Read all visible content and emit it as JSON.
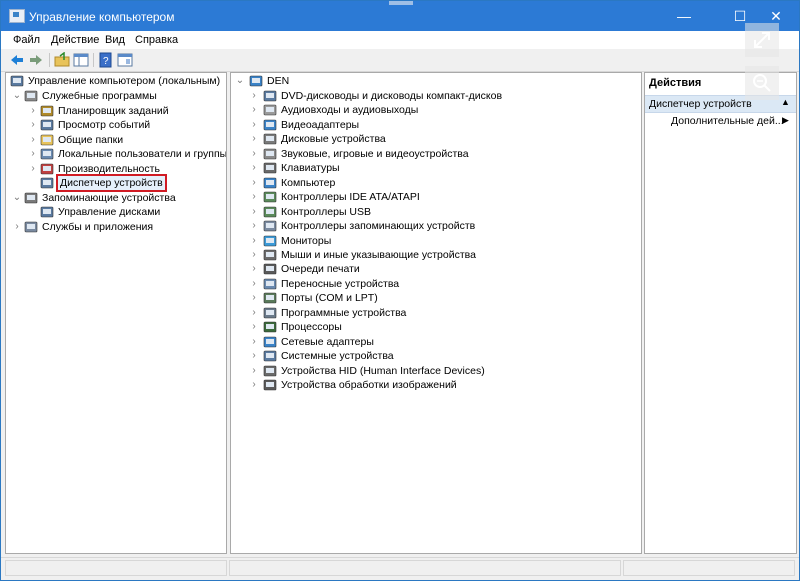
{
  "window": {
    "title": "Управление компьютером",
    "controls": [
      "—",
      "☐",
      "✕"
    ]
  },
  "menu": [
    "Файл",
    "Действие",
    "Вид",
    "Справка"
  ],
  "toolbar": {
    "icons": [
      "back-arrow-icon",
      "forward-arrow-icon",
      "up-folder-icon",
      "show-hide-tree-icon",
      "help-icon",
      "properties-icon"
    ]
  },
  "tree": {
    "root": "Управление компьютером (локальным)",
    "items": [
      {
        "label": "Служебные программы",
        "level": 1,
        "expand": "open"
      },
      {
        "label": "Планировщик заданий",
        "level": 2,
        "expand": "closed"
      },
      {
        "label": "Просмотр событий",
        "level": 2,
        "expand": "closed"
      },
      {
        "label": "Общие папки",
        "level": 2,
        "expand": "closed"
      },
      {
        "label": "Локальные пользователи и группы",
        "level": 2,
        "expand": "closed"
      },
      {
        "label": "Производительность",
        "level": 2,
        "expand": "closed"
      },
      {
        "label": "Диспетчер устройств",
        "level": 2,
        "expand": "none",
        "selected": true
      },
      {
        "label": "Запоминающие устройства",
        "level": 1,
        "expand": "open"
      },
      {
        "label": "Управление дисками",
        "level": 2,
        "expand": "none"
      },
      {
        "label": "Службы и приложения",
        "level": 1,
        "expand": "closed"
      }
    ]
  },
  "devices": {
    "computer_name": "DEN",
    "categories": [
      "DVD-дисководы и дисководы компакт-дисков",
      "Аудиовходы и аудиовыходы",
      "Видеоадаптеры",
      "Дисковые устройства",
      "Звуковые, игровые и видеоустройства",
      "Клавиатуры",
      "Компьютер",
      "Контроллеры IDE ATA/ATAPI",
      "Контроллеры USB",
      "Контроллеры запоминающих устройств",
      "Мониторы",
      "Мыши и иные указывающие устройства",
      "Очереди печати",
      "Переносные устройства",
      "Порты (COM и LPT)",
      "Программные устройства",
      "Процессоры",
      "Сетевые адаптеры",
      "Системные устройства",
      "Устройства HID (Human Interface Devices)",
      "Устройства обработки изображений"
    ]
  },
  "actions": {
    "title": "Действия",
    "section": "Диспетчер устройств",
    "more": "Дополнительные дей..."
  },
  "colors": {
    "titlebar": "#2c7ad5",
    "selection_outline": "#d11b24"
  }
}
